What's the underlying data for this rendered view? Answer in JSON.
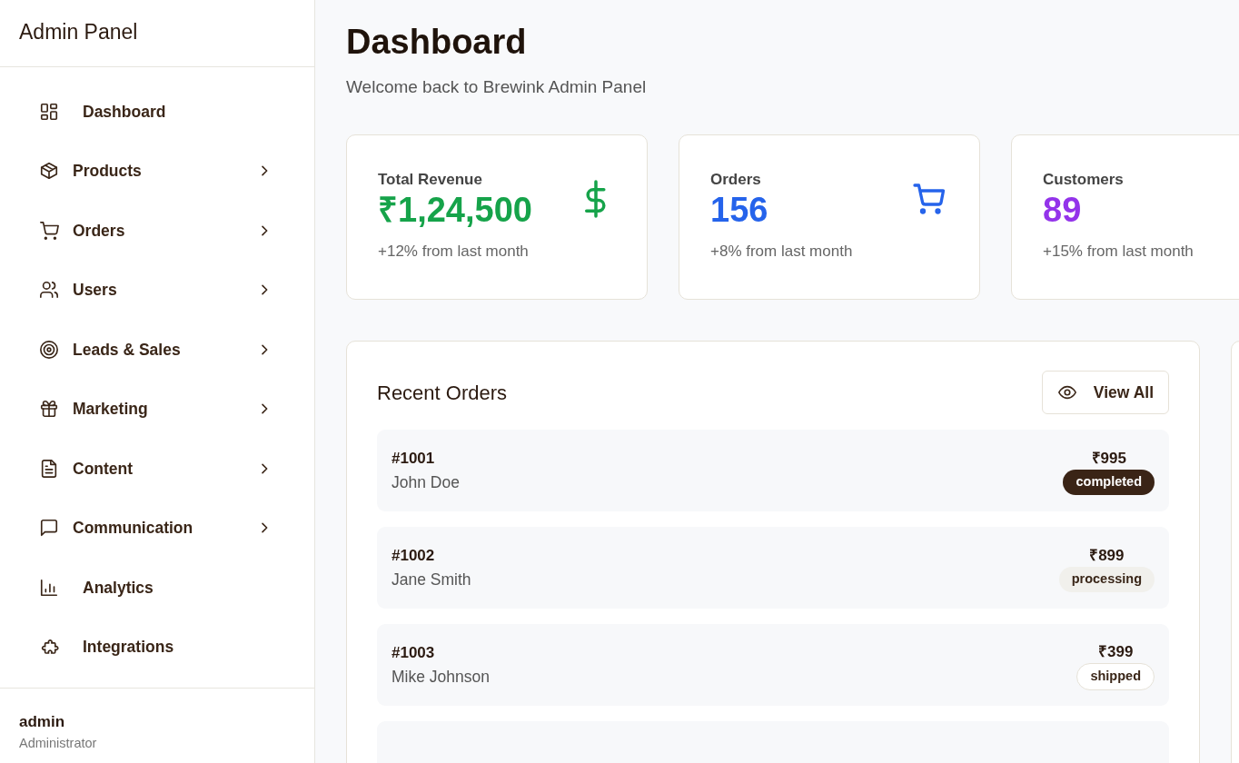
{
  "sidebar": {
    "title": "Admin Panel",
    "items": [
      {
        "label": "Dashboard",
        "kind": "grid",
        "has_submenu": false
      },
      {
        "label": "Products",
        "kind": "box",
        "has_submenu": true
      },
      {
        "label": "Orders",
        "kind": "cart",
        "has_submenu": true
      },
      {
        "label": "Users",
        "kind": "users",
        "has_submenu": true
      },
      {
        "label": "Leads & Sales",
        "kind": "target",
        "has_submenu": true
      },
      {
        "label": "Marketing",
        "kind": "gift",
        "has_submenu": true
      },
      {
        "label": "Content",
        "kind": "file",
        "has_submenu": true
      },
      {
        "label": "Communication",
        "kind": "chat",
        "has_submenu": true
      },
      {
        "label": "Analytics",
        "kind": "chart",
        "has_submenu": false
      },
      {
        "label": "Integrations",
        "kind": "puzzle",
        "has_submenu": false
      }
    ],
    "user": {
      "name": "admin",
      "role": "Administrator"
    }
  },
  "page": {
    "title": "Dashboard",
    "subtitle": "Welcome back to Brewink Admin Panel"
  },
  "stats": [
    {
      "label": "Total Revenue",
      "value": "₹1,24,500",
      "change": "+12% from last month",
      "color": "#16a34a",
      "kind": "dollar"
    },
    {
      "label": "Orders",
      "value": "156",
      "change": "+8% from last month",
      "color": "#2563eb",
      "kind": "cart"
    },
    {
      "label": "Customers",
      "value": "89",
      "change": "+15% from last month",
      "color": "#9333ea",
      "kind": "none"
    }
  ],
  "recent_orders": {
    "title": "Recent Orders",
    "button": "View All",
    "orders": [
      {
        "id": "#1001",
        "customer": "John Doe",
        "amount": "₹995",
        "status": "completed"
      },
      {
        "id": "#1002",
        "customer": "Jane Smith",
        "amount": "₹899",
        "status": "processing"
      },
      {
        "id": "#1003",
        "customer": "Mike Johnson",
        "amount": "₹399",
        "status": "shipped"
      }
    ]
  }
}
